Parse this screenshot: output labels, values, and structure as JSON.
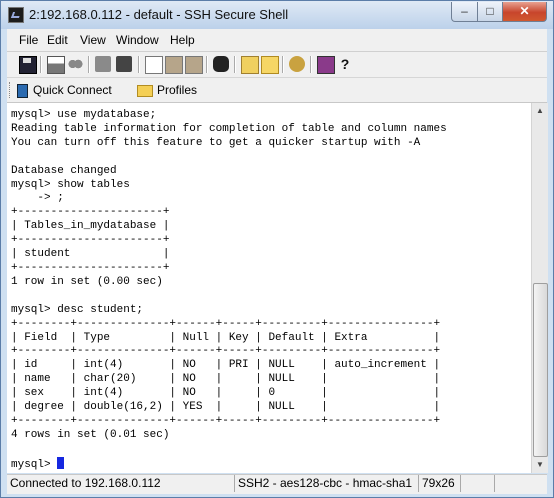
{
  "window": {
    "title": "2:192.168.0.112 - default - SSH Secure Shell",
    "controls": {
      "minimize": "–",
      "maximize": "□",
      "close": "✕"
    }
  },
  "menu": [
    "File",
    "Edit",
    "View",
    "Window",
    "Help"
  ],
  "toolbar": {
    "icons": [
      "save-icon",
      "print-icon",
      "find-icon",
      "disconnect-icon",
      "stamp-icon",
      "copy-icon",
      "paste-icon",
      "paste-special-icon",
      "binoculars-icon",
      "new-terminal-icon",
      "ftp-icon",
      "settings-icon",
      "book-icon",
      "help-cursor-icon"
    ],
    "help_glyph": "?"
  },
  "profilebar": {
    "quick_connect": "Quick Connect",
    "profiles": "Profiles"
  },
  "terminal": {
    "lines": [
      "mysql> use mydatabase;",
      "Reading table information for completion of table and column names",
      "You can turn off this feature to get a quicker startup with -A",
      "",
      "Database changed",
      "mysql> show tables",
      "    -> ;",
      "+----------------------+",
      "| Tables_in_mydatabase |",
      "+----------------------+",
      "| student              |",
      "+----------------------+",
      "1 row in set (0.00 sec)",
      "",
      "mysql> desc student;",
      "+--------+--------------+------+-----+---------+----------------+",
      "| Field  | Type         | Null | Key | Default | Extra          |",
      "+--------+--------------+------+-----+---------+----------------+",
      "| id     | int(4)       | NO   | PRI | NULL    | auto_increment |",
      "| name   | char(20)     | NO   |     | NULL    |                |",
      "| sex    | int(4)       | NO   |     | 0       |                |",
      "| degree | double(16,2) | YES  |     | NULL    |                |",
      "+--------+--------------+------+-----+---------+----------------+",
      "4 rows in set (0.01 sec)",
      ""
    ],
    "prompt": "mysql> "
  },
  "scrollbar": {
    "up": "▲",
    "down": "▼"
  },
  "status": {
    "connection": "Connected to 192.168.0.112",
    "cipher": "SSH2 - aes128-cbc - hmac-sha1",
    "size": "79x26"
  },
  "colors": {
    "cursor": "#1628e0",
    "title_bg": "#cfe0f1",
    "close_button": "#c8452c"
  }
}
